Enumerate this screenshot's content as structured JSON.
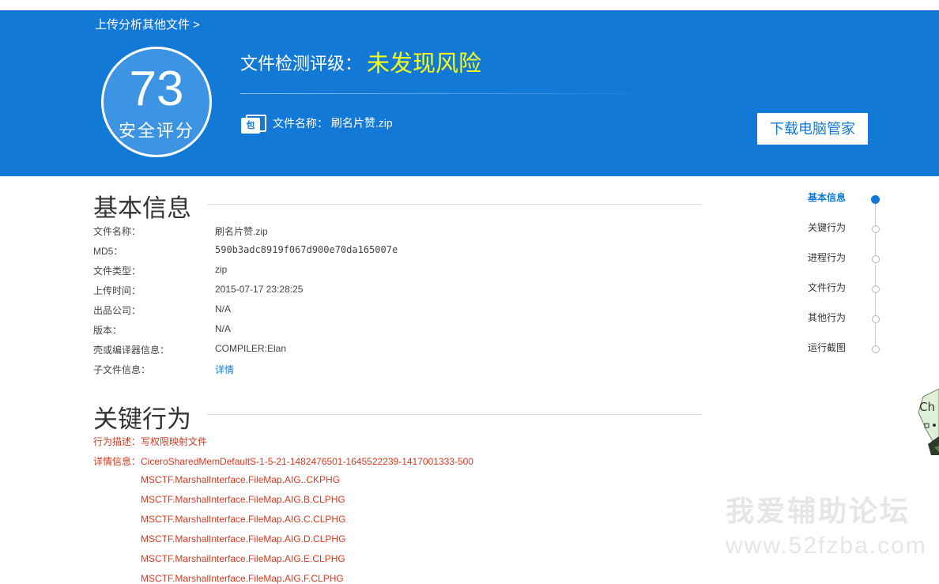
{
  "header": {
    "upload_link": "上传分析其他文件 >",
    "score": "73",
    "score_label": "安全评分",
    "rating_label": "文件检测评级：",
    "rating_value": "未发现风险",
    "file_name_label": "文件名称：",
    "file_name": "刷名片赞.zip",
    "pkg_icon_text": "包",
    "download_button": "下载电脑管家",
    "colors": {
      "banner": "#1379d6",
      "rating_value": "#f6ff18"
    }
  },
  "basic_info": {
    "title": "基本信息",
    "rows": [
      {
        "key": "文件名称：",
        "value": "刷名片赞.zip"
      },
      {
        "key": "MD5：",
        "value": "590b3adc8919f067d900e70da165007e"
      },
      {
        "key": "文件类型：",
        "value": "zip"
      },
      {
        "key": "上传时间：",
        "value": "2015-07-17 23:28:25"
      },
      {
        "key": "出品公司：",
        "value": "N/A"
      },
      {
        "key": "版本：",
        "value": "N/A"
      },
      {
        "key": "壳或编译器信息：",
        "value": "COMPILER:Elan"
      },
      {
        "key": "子文件信息：",
        "value": "详情"
      }
    ]
  },
  "key_behavior": {
    "title": "关键行为",
    "desc_line": "行为描述：写权限映射文件",
    "detail_line": "详情信息：CiceroSharedMemDefaultS-1-5-21-1482476501-1645522239-1417001333-500",
    "details": [
      "MSCTF.MarshalInterface.FileMap.AIG..CKPHG",
      "MSCTF.MarshalInterface.FileMap.AIG.B.CLPHG",
      "MSCTF.MarshalInterface.FileMap.AIG.C.CLPHG",
      "MSCTF.MarshalInterface.FileMap.AIG.D.CLPHG",
      "MSCTF.MarshalInterface.FileMap.AIG.E.CLPHG",
      "MSCTF.MarshalInterface.FileMap.AIG.F.CLPHG"
    ],
    "color": "#d9381e"
  },
  "side_nav": {
    "items": [
      "基本信息",
      "关键行为",
      "进程行为",
      "文件行为",
      "其他行为",
      "运行截图"
    ],
    "active": "基本信息"
  },
  "watermark": {
    "line1": "我爱辅助论坛",
    "line2": "www.52fzba.com"
  },
  "mascot_text": "Ch"
}
